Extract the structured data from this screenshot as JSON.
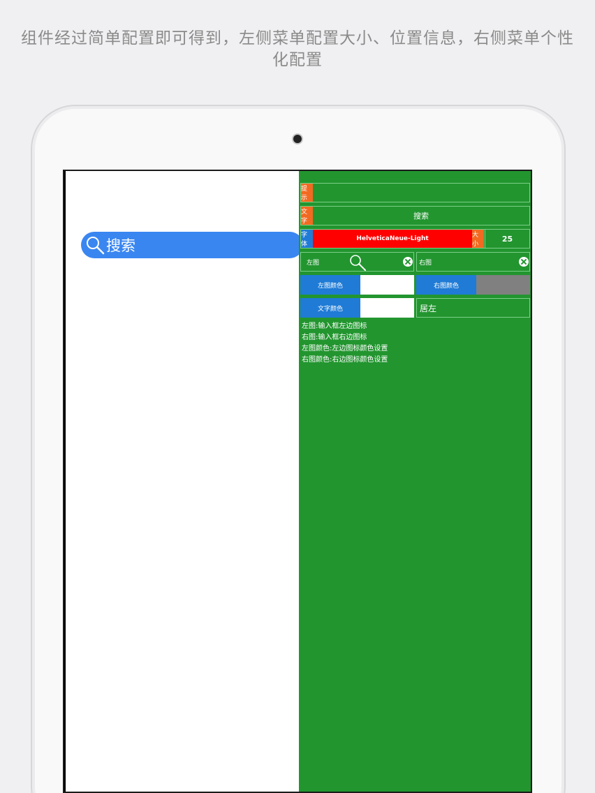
{
  "caption": {
    "line1": "组件经过简单配置即可得到，左侧菜单配置大小、位置信息，右侧菜单个性",
    "line2": "化配置"
  },
  "demo": {
    "search_text": "搜索",
    "icon": "search-icon",
    "bar_color": "#3a86f1"
  },
  "config": {
    "placeholder_tag": "提示",
    "placeholder_value": "",
    "text_tag": "文字",
    "text_value": "搜索",
    "font_tag": "字体",
    "font_value": "HelveticaNeue-Light",
    "size_tag": "大小",
    "size_value": "25",
    "left_image_label": "左图",
    "left_image_icon": "search-icon",
    "right_image_label": "右图",
    "clear_icon": "clear-icon",
    "left_color_label": "左图颜色",
    "left_color_value": "#ffffff",
    "right_color_label": "右图颜色",
    "right_color_value": "#808080",
    "text_color_label": "文字颜色",
    "text_color_value": "#ffffff",
    "alignment_value": "居左"
  },
  "notes": [
    "左图:输入框左边图标",
    "右图:输入框右边图标",
    "左图颜色:左边图标颜色设置",
    "右图颜色:右边图标颜色设置"
  ],
  "colors": {
    "panel_green": "#22952f",
    "tag_orange": "#f26a21",
    "font_red": "#ff0000",
    "label_blue": "#1f7bd6"
  }
}
